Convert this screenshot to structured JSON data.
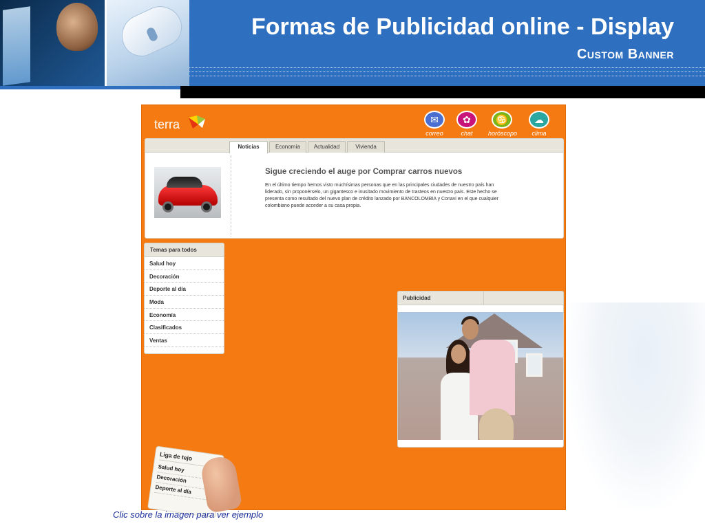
{
  "slide": {
    "title": "Formas de Publicidad online - Display",
    "subtitle": "Custom Banner",
    "caption": "Clic sobre la imagen para ver ejemplo"
  },
  "portal": {
    "logo": "terra",
    "icons": [
      {
        "label": "correo",
        "icon": "envelope-icon",
        "glyph": "✉"
      },
      {
        "label": "chat",
        "icon": "chat-icon",
        "glyph": "✿"
      },
      {
        "label": "horóscopo",
        "icon": "horoscope-icon",
        "glyph": "♋"
      },
      {
        "label": "clima",
        "icon": "weather-icon",
        "glyph": "☁"
      }
    ],
    "tabs": [
      "Noticias",
      "Economía",
      "Actualidad",
      "Vivienda"
    ],
    "news": {
      "headline": "Sigue creciendo el auge por Comprar carros nuevos",
      "body": "En el último tiempo hemos visto muchísimas personas que en las principales ciudades de nuestro país han liderado, sin proponérselo, un gigantesco e inusitado movimiento de trasteos en nuestro país.  Este hecho se presenta como resultado del nuevo plan de crédito lanzado por BANCOLOMBIA y  Conavi en el que cualquier colombiano puede acceder a su casa propia."
    },
    "topics": {
      "header": "Temas para todos",
      "items": [
        "Salud hoy",
        "Decoración",
        "Deporte al día",
        "Moda",
        "Economía",
        "Clasificados",
        "Ventas"
      ]
    },
    "ad": {
      "header": "Publicidad"
    },
    "hand_card": {
      "header": "Liga de tejo",
      "items": [
        "Salud hoy",
        "Decoración",
        "Deporte al día"
      ]
    },
    "colors": {
      "portal_orange": "#f57a12",
      "header_blue": "#2f6fbf",
      "caption_blue": "#1c2f9a"
    }
  }
}
